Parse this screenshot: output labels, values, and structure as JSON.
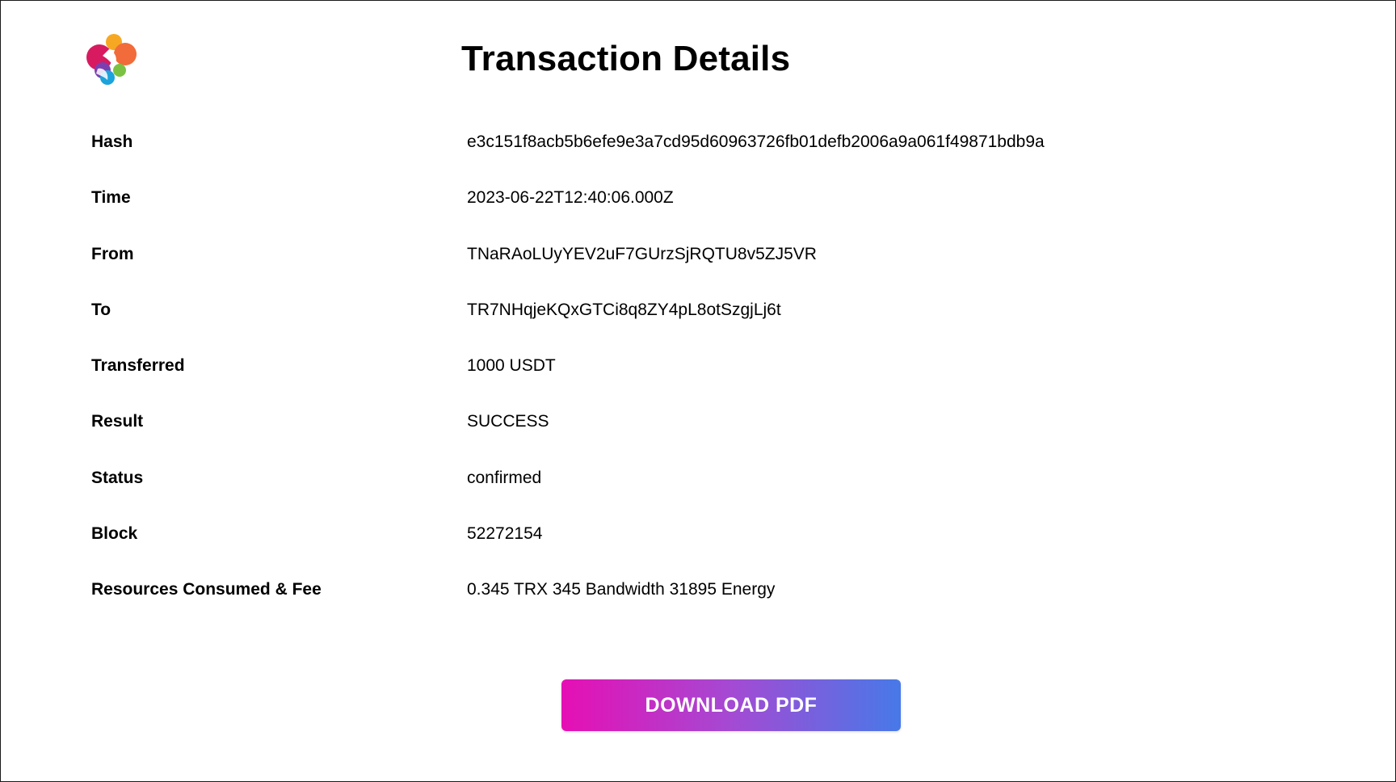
{
  "header": {
    "title": "Transaction Details",
    "logo_icon": "brand-logo-icon"
  },
  "details": [
    {
      "label": "Hash",
      "value": "e3c151f8acb5b6efe9e3a7cd95d60963726fb01defb2006a9a061f49871bdb9a"
    },
    {
      "label": "Time",
      "value": "2023-06-22T12:40:06.000Z"
    },
    {
      "label": "From",
      "value": "TNaRAoLUyYEV2uF7GUrzSjRQTU8v5ZJ5VR"
    },
    {
      "label": "To",
      "value": "TR7NHqjeKQxGTCi8q8ZY4pL8otSzgjLj6t"
    },
    {
      "label": "Transferred",
      "value": "1000 USDT"
    },
    {
      "label": "Result",
      "value": "SUCCESS"
    },
    {
      "label": "Status",
      "value": "confirmed"
    },
    {
      "label": "Block",
      "value": "52272154"
    },
    {
      "label": "Resources Consumed & Fee",
      "value": "0.345 TRX 345 Bandwidth 31895 Energy"
    }
  ],
  "actions": {
    "download_label": "DOWNLOAD PDF"
  },
  "colors": {
    "button_gradient_start": "#e60fb4",
    "button_gradient_end": "#4779e8",
    "logo_colors": [
      "#d81b60",
      "#f7a823",
      "#f26b3a",
      "#7c3fb0",
      "#1ca3dc",
      "#7cc242"
    ]
  }
}
